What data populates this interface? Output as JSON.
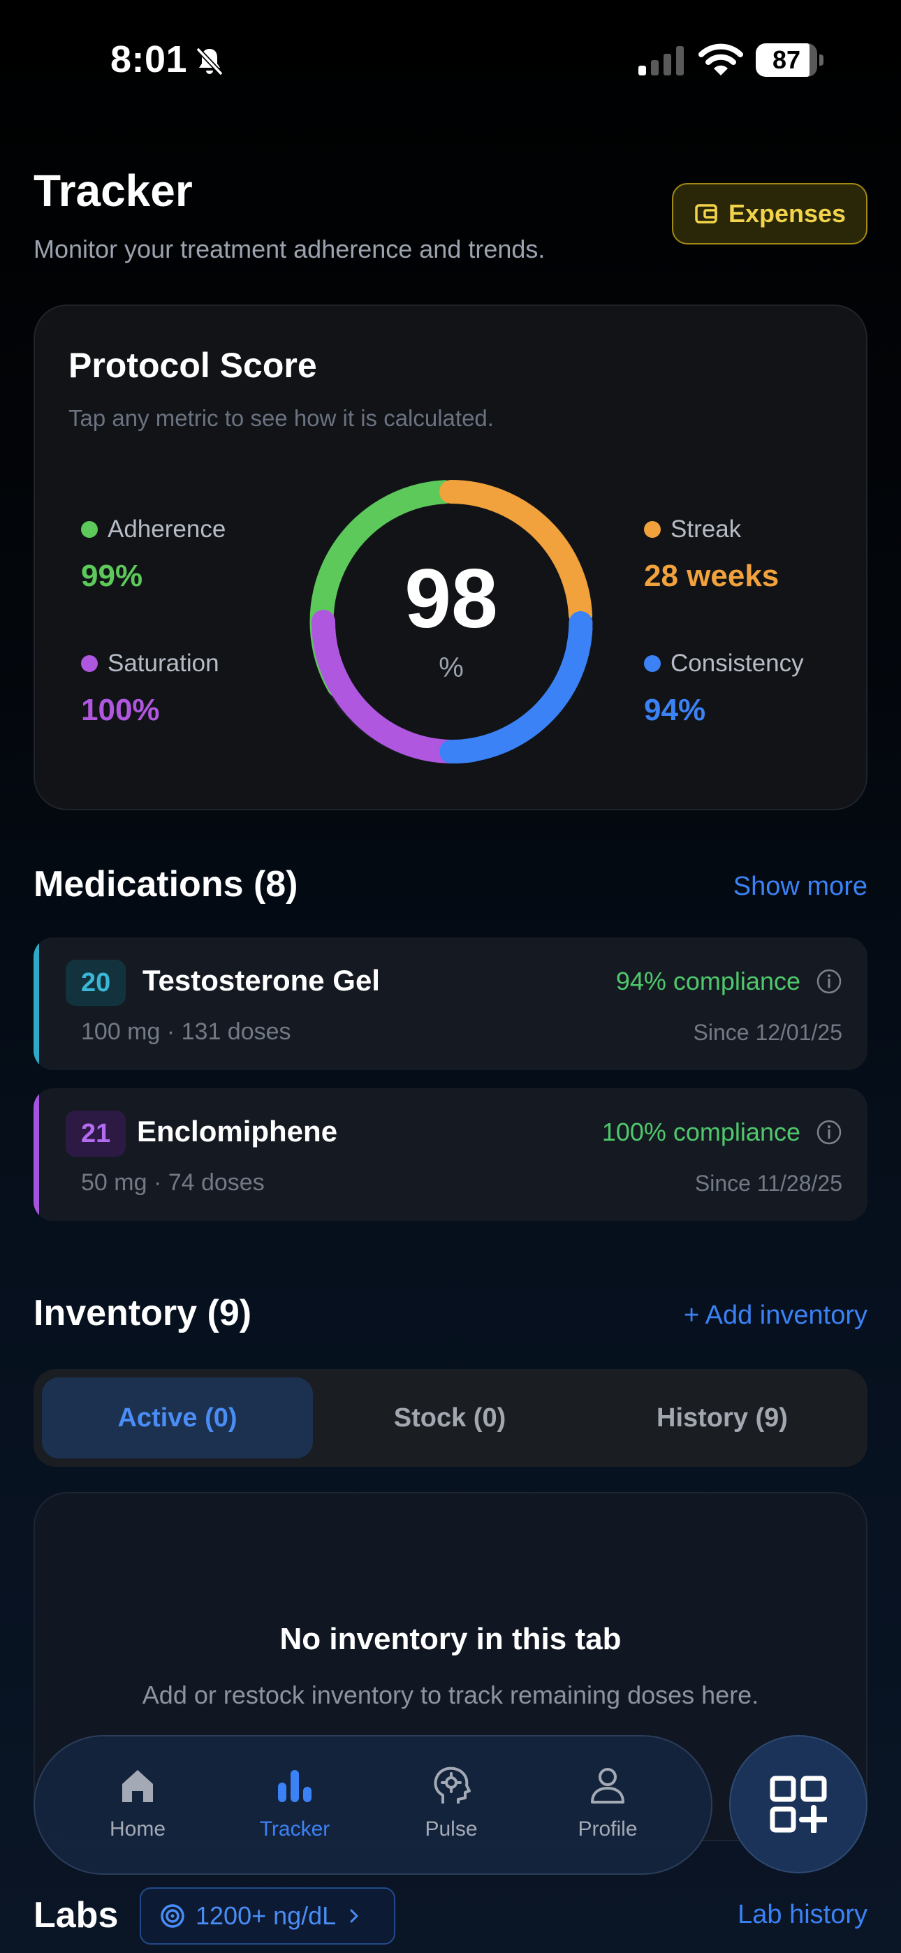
{
  "status_bar": {
    "time": "8:01",
    "battery": "87",
    "battery_level": 0.87
  },
  "header": {
    "title": "Tracker",
    "subtitle": "Monitor your treatment adherence and trends.",
    "expenses_label": "Expenses"
  },
  "score_card": {
    "title": "Protocol Score",
    "hint": "Tap any metric to see how it is calculated.",
    "score": "98",
    "unit": "%",
    "metrics": [
      {
        "label": "Adherence",
        "value": "99%",
        "color": "#5cc95a"
      },
      {
        "label": "Saturation",
        "value": "100%",
        "color": "#b057e0"
      },
      {
        "label": "Streak",
        "value": "28 weeks",
        "color": "#f2a23c"
      },
      {
        "label": "Consistency",
        "value": "94%",
        "color": "#3b82f6"
      }
    ]
  },
  "medications": {
    "title": "Medications (8)",
    "show_more": "Show more",
    "items": [
      {
        "badge": "20",
        "name": "Testosterone Gel",
        "compliance": "94% compliance",
        "detail": "100 mg · 131 doses",
        "since": "Since 12/01/25",
        "accent": "#2fa9c9",
        "badge_bg": "#12323d",
        "badge_color": "#3ab6d6"
      },
      {
        "badge": "21",
        "name": "Enclomiphene",
        "compliance": "100% compliance",
        "detail": "50 mg · 74 doses",
        "since": "Since 11/28/25",
        "accent": "#a455e0",
        "badge_bg": "#2c1a44",
        "badge_color": "#b36bf0"
      }
    ]
  },
  "inventory": {
    "title": "Inventory (9)",
    "add_label": "+ Add inventory",
    "tabs": [
      {
        "label": "Active (0)",
        "active": true
      },
      {
        "label": "Stock (0)",
        "active": false
      },
      {
        "label": "History (9)",
        "active": false
      }
    ],
    "empty_title": "No inventory in this tab",
    "empty_desc": "Add or restock inventory to track remaining doses here."
  },
  "nav": {
    "items": [
      {
        "label": "Home",
        "icon": "home-icon"
      },
      {
        "label": "Tracker",
        "icon": "bar-chart-icon",
        "active": true
      },
      {
        "label": "Pulse",
        "icon": "head-gear-icon"
      },
      {
        "label": "Profile",
        "icon": "person-icon"
      }
    ],
    "fab_icon": "qr-add-icon"
  },
  "labs": {
    "title": "Labs",
    "chip_label": "1200+ ng/dL",
    "history_link": "Lab history"
  }
}
